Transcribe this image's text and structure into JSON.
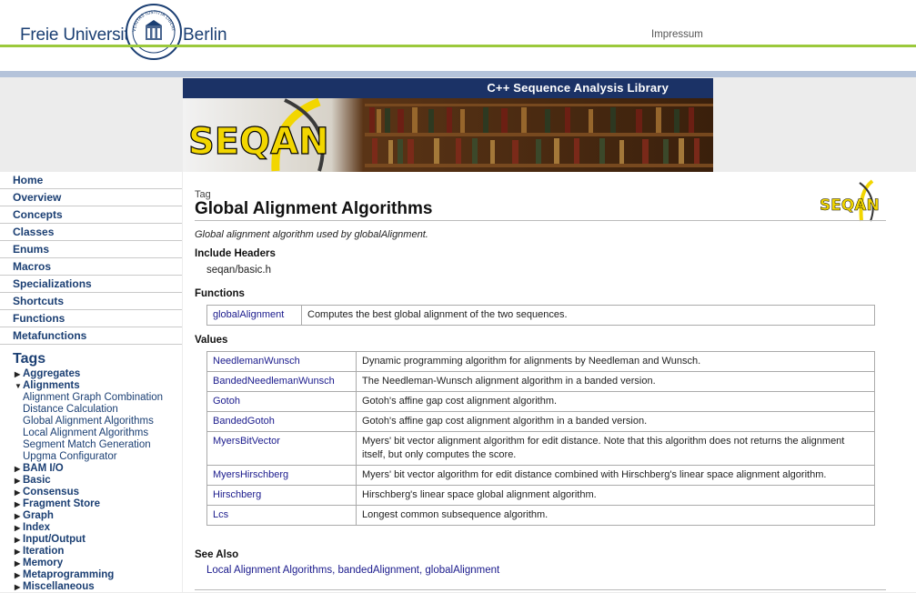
{
  "header": {
    "university_left": "Freie Universität",
    "university_right": "Berlin",
    "impressum": "Impressum",
    "seal_text": "VERITAS IUSTITIA LIBERTAS"
  },
  "banner": {
    "title": "C++ Sequence Analysis Library",
    "logo_text": "SEQAN"
  },
  "sidebar": {
    "nav": [
      "Home",
      "Overview",
      "Concepts",
      "Classes",
      "Enums",
      "Macros",
      "Specializations",
      "Shortcuts",
      "Functions",
      "Metafunctions"
    ],
    "tags_heading": "Tags",
    "tags": [
      {
        "label": "Aggregates",
        "expanded": false
      },
      {
        "label": "Alignments",
        "expanded": true,
        "children": [
          "Alignment Graph Combination",
          "Distance Calculation",
          "Global Alignment Algorithms",
          "Local Alignment Algorithms",
          "Segment Match Generation",
          "Upgma Configurator"
        ]
      },
      {
        "label": "BAM I/O",
        "expanded": false
      },
      {
        "label": "Basic",
        "expanded": false
      },
      {
        "label": "Consensus",
        "expanded": false
      },
      {
        "label": "Fragment Store",
        "expanded": false
      },
      {
        "label": "Graph",
        "expanded": false
      },
      {
        "label": "Index",
        "expanded": false
      },
      {
        "label": "Input/Output",
        "expanded": false
      },
      {
        "label": "Iteration",
        "expanded": false
      },
      {
        "label": "Memory",
        "expanded": false
      },
      {
        "label": "Metaprogramming",
        "expanded": false
      },
      {
        "label": "Miscellaneous",
        "expanded": false
      }
    ]
  },
  "main": {
    "kind": "Tag",
    "title": "Global Alignment Algorithms",
    "summary": "Global alignment algorithm used by globalAlignment.",
    "include_heading": "Include Headers",
    "include_value": "seqan/basic.h",
    "functions_heading": "Functions",
    "functions": [
      {
        "name": "globalAlignment",
        "desc": "Computes the best global alignment of the two sequences."
      }
    ],
    "values_heading": "Values",
    "values": [
      {
        "name": "NeedlemanWunsch",
        "desc": "Dynamic programming algorithm for alignments by Needleman and Wunsch."
      },
      {
        "name": "BandedNeedlemanWunsch",
        "desc": "The Needleman-Wunsch alignment algorithm in a banded version."
      },
      {
        "name": "Gotoh",
        "desc": "Gotoh's affine gap cost alignment algorithm."
      },
      {
        "name": "BandedGotoh",
        "desc": "Gotoh's affine gap cost alignment algorithm in a banded version."
      },
      {
        "name": "MyersBitVector",
        "desc": "Myers' bit vector alignment algorithm for edit distance. Note that this algorithm does not returns the alignment itself, but only computes the score."
      },
      {
        "name": "MyersHirschberg",
        "desc": "Myers' bit vector algorithm for edit distance combined with Hirschberg's linear space alignment algorithm."
      },
      {
        "name": "Hirschberg",
        "desc": "Hirschberg's linear space global alignment algorithm."
      },
      {
        "name": "Lcs",
        "desc": "Longest common subsequence algorithm."
      }
    ],
    "see_also_heading": "See Also",
    "see_also": [
      "Local Alignment Algorithms",
      "bandedAlignment",
      "globalAlignment"
    ]
  }
}
